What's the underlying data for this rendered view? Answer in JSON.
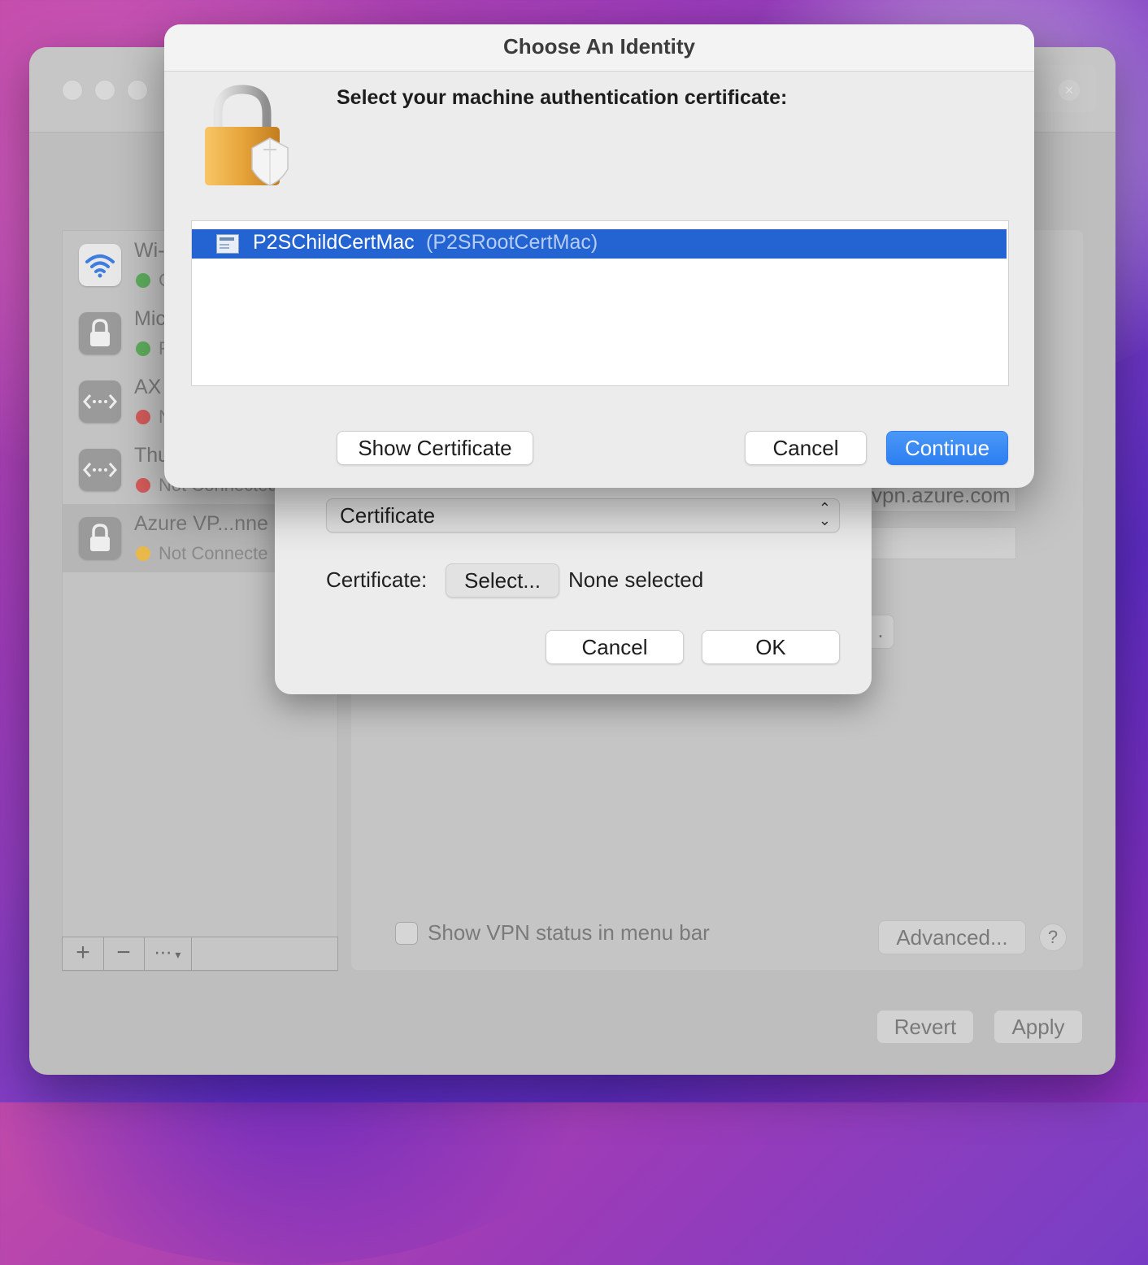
{
  "dialog": {
    "title": "Choose An Identity",
    "prompt": "Select your machine authentication certificate:",
    "certificates": [
      {
        "name": "P2SChildCertMac",
        "issuer": "(P2SRootCertMac)"
      }
    ],
    "show_certificate_label": "Show Certificate",
    "cancel_label": "Cancel",
    "continue_label": "Continue"
  },
  "auth_sheet": {
    "auth_method": "Certificate",
    "certificate_label": "Certificate:",
    "select_label": "Select...",
    "selected_value": "None selected",
    "cancel_label": "Cancel",
    "ok_label": "OK"
  },
  "sidebar": {
    "services": [
      {
        "name": "Wi-",
        "status": "C",
        "status_color": "#5fae5f",
        "icon": "wifi-icon"
      },
      {
        "name": "Mic",
        "status": "F",
        "status_color": "#5fae5f",
        "icon": "lock-icon"
      },
      {
        "name": "AX",
        "status": "N",
        "status_color": "#d65c5c",
        "icon": "vpn-arrows-icon"
      },
      {
        "name": "Thu",
        "status": "Not Connected",
        "status_color": "#d65c5c",
        "icon": "vpn-arrows-icon"
      },
      {
        "name": "Azure VP...nne",
        "status": "Not Connecte",
        "status_color": "#e8b84a",
        "icon": "lock-icon"
      }
    ],
    "add_label": "+",
    "remove_label": "−",
    "more_label": "⋯"
  },
  "detail": {
    "server_partial": "vpn.azure.com",
    "dots_partial": ".",
    "show_vpn_status_label": "Show VPN status in menu bar",
    "advanced_label": "Advanced...",
    "help_label": "?",
    "revert_label": "Revert",
    "apply_label": "Apply"
  },
  "colors": {
    "accent": "#2d7ef0",
    "selection": "#2364d2"
  }
}
